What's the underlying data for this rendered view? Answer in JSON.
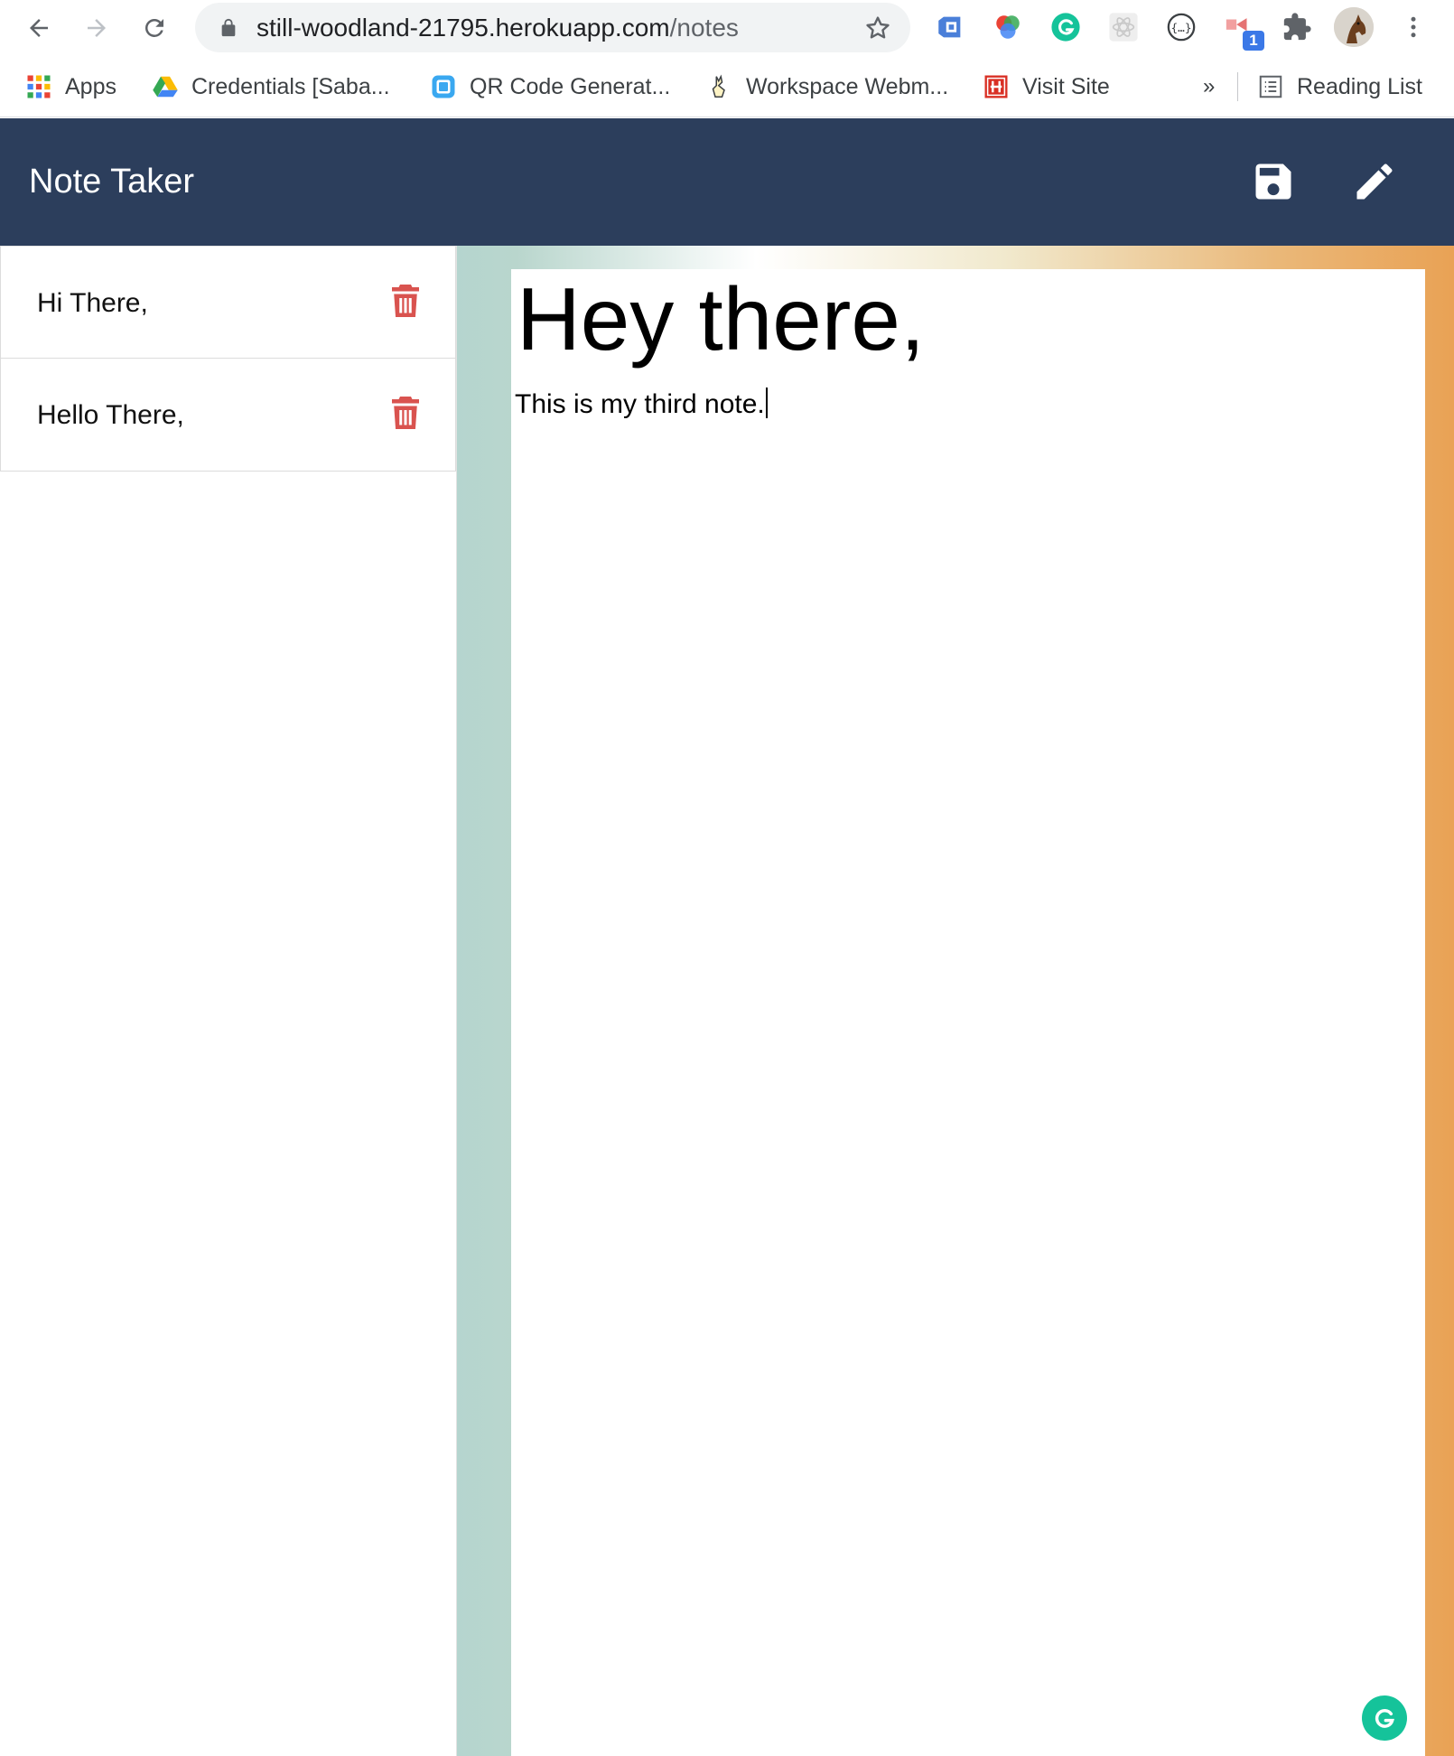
{
  "browser": {
    "url_host": "still-woodland-21795.herokuapp.com",
    "url_path": "/notes",
    "extension_badge": "1",
    "bookmarks": [
      {
        "label": "Apps"
      },
      {
        "label": "Credentials [Saba..."
      },
      {
        "label": "QR Code Generat..."
      },
      {
        "label": "Workspace Webm..."
      },
      {
        "label": "Visit Site"
      }
    ],
    "overflow_label": "»",
    "reading_list_label": "Reading List"
  },
  "app": {
    "title": "Note Taker",
    "nav_color": "#2c3e5c",
    "actions": [
      {
        "icon": "save-icon"
      },
      {
        "icon": "pencil-icon"
      }
    ]
  },
  "notes": [
    {
      "title": "Hi There,"
    },
    {
      "title": "Hello There,"
    }
  ],
  "editor": {
    "title": "Hey there,",
    "body": "This is my third note."
  },
  "colors": {
    "delete": "#d9534f",
    "grammarly": "#15c39a"
  }
}
